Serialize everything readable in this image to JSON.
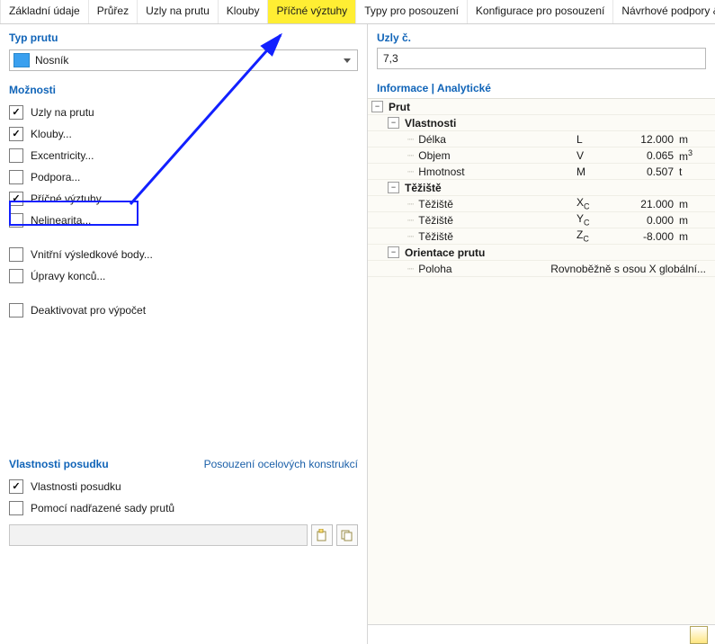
{
  "tabs": [
    {
      "label": "Základní údaje"
    },
    {
      "label": "Průřez"
    },
    {
      "label": "Uzly na prutu"
    },
    {
      "label": "Klouby"
    },
    {
      "label": "Příčné výztuhy",
      "highlight": true
    },
    {
      "label": "Typy pro posouzení"
    },
    {
      "label": "Konfigurace pro posouzení"
    },
    {
      "label": "Návrhové podpory & prů"
    }
  ],
  "left": {
    "typ_prutu_head": "Typ prutu",
    "typ_prutu_value": "Nosník",
    "moznosti_head": "Možnosti",
    "checks": [
      {
        "label": "Uzly na prutu",
        "checked": true
      },
      {
        "label": "Klouby...",
        "checked": true
      },
      {
        "label": "Excentricity...",
        "checked": false
      },
      {
        "label": "Podpora...",
        "checked": false
      },
      {
        "label": "Příčné výztuhy...",
        "checked": true,
        "boxed": true
      },
      {
        "label": "Nelinearita...",
        "checked": false
      },
      {
        "label": "Vnitřní výsledkové body...",
        "checked": false,
        "gap": true
      },
      {
        "label": "Úpravy konců...",
        "checked": false
      },
      {
        "label": "Deaktivovat pro výpočet",
        "checked": false,
        "gap": true
      }
    ],
    "posudek_head": "Vlastnosti posudku",
    "posudek_link": "Posouzení ocelových konstrukcí",
    "posudek_checks": [
      {
        "label": "Vlastnosti posudku",
        "checked": true
      },
      {
        "label": "Pomocí nadřazené sady prutů",
        "checked": false
      }
    ]
  },
  "right": {
    "uzly_head": "Uzly č.",
    "uzly_value": "7,3",
    "info_head": "Informace | Analytické",
    "root": "Prut",
    "groups": [
      {
        "name": "Vlastnosti",
        "rows": [
          {
            "lbl": "Délka",
            "sym": "L",
            "val": "12.000",
            "unit": "m"
          },
          {
            "lbl": "Objem",
            "sym": "V",
            "val": "0.065",
            "unit": "m3",
            "sup": true
          },
          {
            "lbl": "Hmotnost",
            "sym": "M",
            "val": "0.507",
            "unit": "t"
          }
        ]
      },
      {
        "name": "Těžiště",
        "rows": [
          {
            "lbl": "Těžiště",
            "sym": "XC",
            "val": "21.000",
            "unit": "m",
            "sub": true
          },
          {
            "lbl": "Těžiště",
            "sym": "YC",
            "val": "0.000",
            "unit": "m",
            "sub": true
          },
          {
            "lbl": "Těžiště",
            "sym": "ZC",
            "val": "-8.000",
            "unit": "m",
            "sub": true
          }
        ]
      },
      {
        "name": "Orientace prutu",
        "rows": [
          {
            "lbl": "Poloha",
            "long": "Rovnoběžně s osou X globální..."
          }
        ]
      }
    ]
  }
}
